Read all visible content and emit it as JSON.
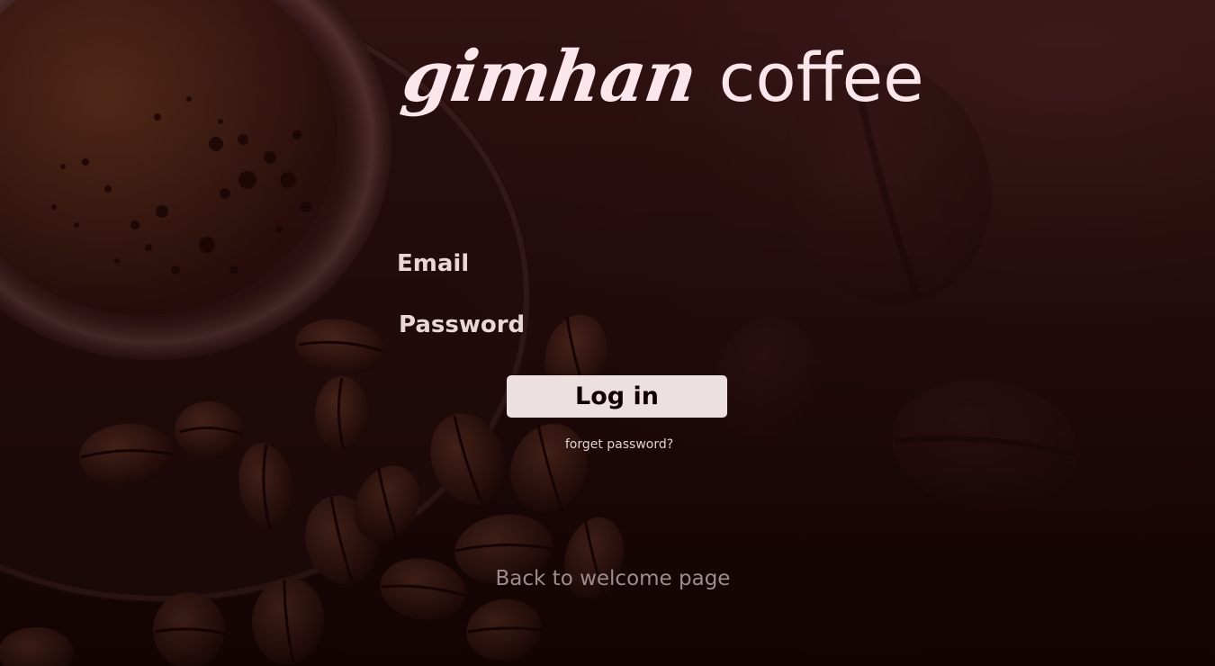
{
  "brand": {
    "script": "gimhan",
    "word": "coffee"
  },
  "form": {
    "email_label": "Email",
    "email_value": "",
    "password_label": "Password",
    "password_value": "",
    "login_label": "Log in",
    "forgot_label": "forget password?"
  },
  "footer": {
    "back_label": "Back to welcome page"
  },
  "colors": {
    "background": "#2a0f0f",
    "title": "#fbe6ec",
    "label": "#e8d6d8",
    "button_bg": "#ece0e1",
    "button_text": "#120404",
    "link_muted": "#9c8c8f"
  },
  "decor": {
    "background_image": "coffee-cup-and-beans"
  }
}
